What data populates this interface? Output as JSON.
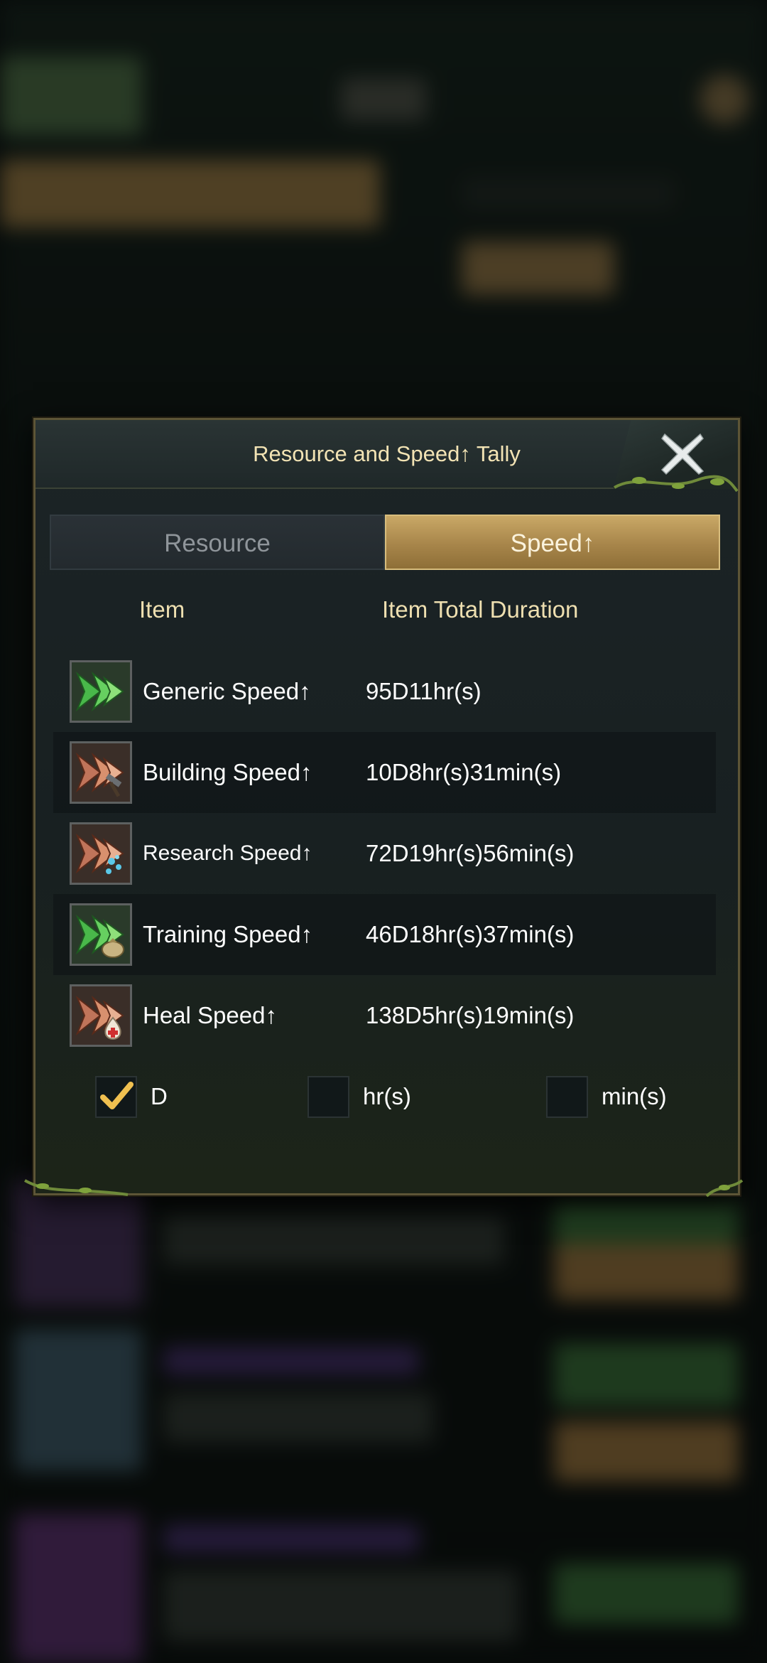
{
  "dialog": {
    "title": "Resource and Speed↑ Tally"
  },
  "tabs": [
    {
      "label": "Resource",
      "active": false
    },
    {
      "label": "Speed↑",
      "active": true
    }
  ],
  "columns": {
    "item": "Item",
    "duration": "Item Total Duration"
  },
  "rows": [
    {
      "name": "Generic Speed↑",
      "duration": "95D11hr(s)",
      "icon": "green-arrows-icon"
    },
    {
      "name": "Building Speed↑",
      "duration": "10D8hr(s)31min(s)",
      "icon": "building-speedup-icon"
    },
    {
      "name": "Research Speed↑",
      "duration": "72D19hr(s)56min(s)",
      "icon": "research-speedup-icon"
    },
    {
      "name": "Training Speed↑",
      "duration": "46D18hr(s)37min(s)",
      "icon": "training-speedup-icon"
    },
    {
      "name": "Heal Speed↑",
      "duration": "138D5hr(s)19min(s)",
      "icon": "heal-speedup-icon"
    }
  ],
  "units": [
    {
      "label": "D",
      "checked": true
    },
    {
      "label": "hr(s)",
      "checked": false
    },
    {
      "label": "min(s)",
      "checked": false
    }
  ],
  "colors": {
    "title": "#f2e3b4",
    "active_tab": "#b8954f",
    "check": "#f0c050"
  }
}
